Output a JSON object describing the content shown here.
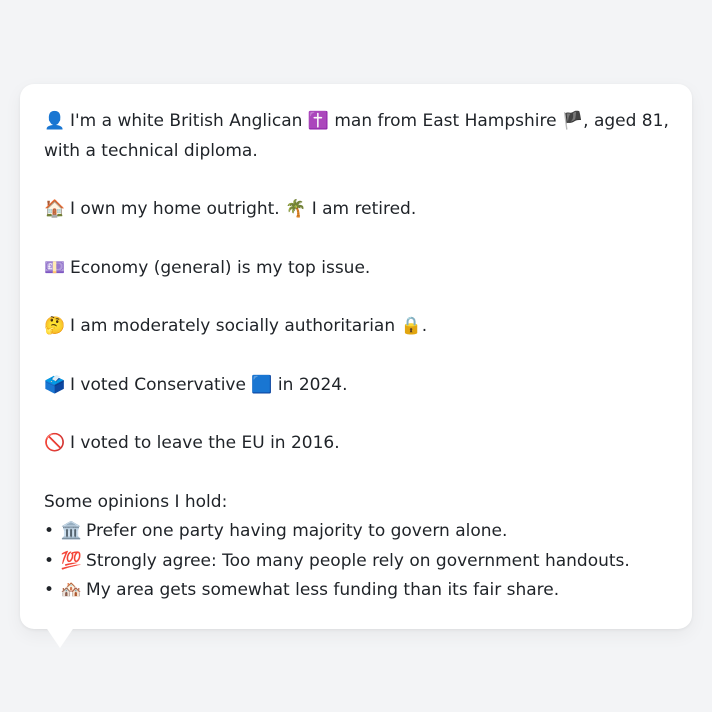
{
  "profile": {
    "intro": {
      "icon": "👤",
      "part1": "I'm a white British Anglican",
      "religion_icon": "✝️",
      "part2": "man from East Hampshire",
      "flag_icon": "🏴",
      "part3": ", aged 81,",
      "part4": "with a technical diploma."
    },
    "home": {
      "icon": "🏠",
      "text1": "I own my home outright.",
      "retired_icon": "🌴",
      "text2": "I am retired."
    },
    "issue": {
      "icon": "💷",
      "text": "Economy (general) is my top issue."
    },
    "social": {
      "icon": "🤔",
      "text": "I am moderately socially authoritarian",
      "lock_icon": "🔒",
      "end": "."
    },
    "vote": {
      "icon": "🗳️",
      "text1": "I voted Conservative",
      "party_icon": "🟦",
      "text2": "in 2024."
    },
    "eu": {
      "icon": "🚫",
      "text": "I voted to leave the EU in 2016."
    },
    "opinions_heading": "Some opinions I hold:",
    "bullet": "•",
    "opinions": [
      {
        "icon": "🏛️",
        "text": "Prefer one party having majority to govern alone."
      },
      {
        "icon": "💯",
        "text": "Strongly agree: Too many people rely on government handouts."
      },
      {
        "icon": "🏘️",
        "text": "My area gets somewhat less funding than its fair share."
      }
    ]
  },
  "colors": {
    "background": "#f3f4f6",
    "bubble": "#ffffff",
    "text": "#1f2328"
  }
}
